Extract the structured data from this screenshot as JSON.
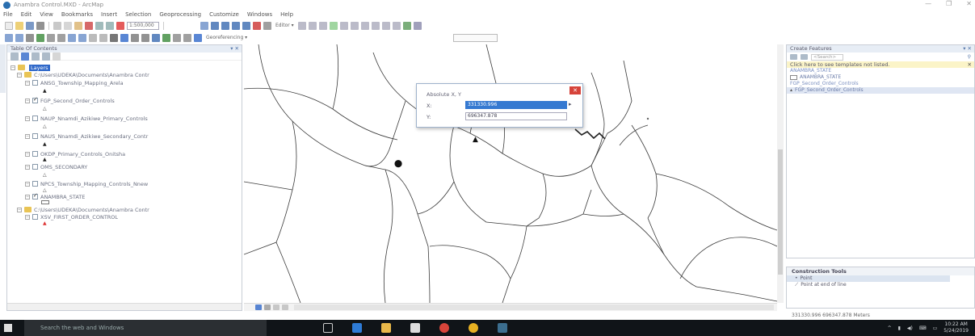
{
  "window": {
    "title": "Anambra Control.MXD - ArcMap",
    "controls": [
      "—",
      "❐",
      "✕"
    ]
  },
  "menu": [
    "File",
    "Edit",
    "View",
    "Bookmarks",
    "Insert",
    "Selection",
    "Geoprocessing",
    "Customize",
    "Windows",
    "Help"
  ],
  "toolbar": {
    "scale": "1:500,000",
    "editor_label": "Editor ▾",
    "georef_label": "Georeferencing ▾"
  },
  "toc": {
    "title": "Table Of Contents",
    "layers_label": "Layers",
    "rows": [
      "C:\\Users\\UDEKA\\Documents\\Anambra Contr",
      "ANSG_Township_Mapping_Arela",
      "FGP_Second_Order_Controls",
      "NAUP_Nnamdi_Azikiwe_Primary_Controls",
      "NAUS_Nnamdi_Azikiwe_Secondary_Contr",
      "OKDP_Primary_Controls_Onitsha",
      "OMS_SECONDARY",
      "NPCS_Township_Mapping_Controls_Nnew",
      "ANAMBRA_STATE",
      "C:\\Users\\UDEKA\\Documents\\Anambra Contr",
      "XSV_FIRST_ORDER_CONTROL"
    ]
  },
  "dialog": {
    "title": "Absolute X, Y",
    "close": "✕",
    "x_label": "X:",
    "y_label": "Y:",
    "x_value": "331330.996",
    "y_value": "696347.878"
  },
  "create_features": {
    "title": "Create Features",
    "search_placeholder": "<Search>",
    "notice": "Click here to see templates not listed.",
    "items": [
      "ANAMBRA_STATE",
      "ANAMBRA_STATE",
      "FGP_Second_Order_Controls",
      "FGP_Second_Order_Controls"
    ]
  },
  "construction_tools": {
    "title": "Construction Tools",
    "items": [
      "Point",
      "Point at end of line"
    ]
  },
  "status": {
    "coordinates": "331330.996  696347.878 Meters"
  },
  "taskbar": {
    "search_placeholder": "Search the web and Windows",
    "time": "10:22 AM",
    "date": "5/24/2019"
  },
  "colors": {
    "accent": "#3579d1",
    "taskbar": "#101418",
    "close": "#d6433a"
  }
}
